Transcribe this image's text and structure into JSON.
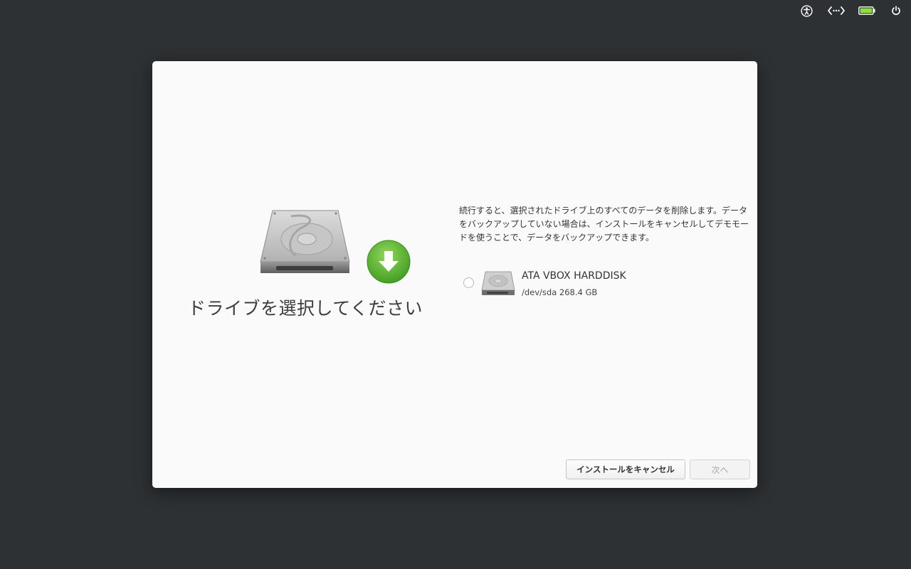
{
  "tray": {
    "icons": [
      "accessibility-icon",
      "network-icon",
      "battery-icon",
      "power-icon"
    ],
    "battery_color": "#8ae234"
  },
  "installer": {
    "title": "ドライブを選択してください",
    "description": "続行すると、選択されたドライブ上のすべてのデータを削除します。データをバックアップしていない場合は、インストールをキャンセルしてデモモードを使うことで、データをバックアップできます。",
    "drives": [
      {
        "name": "ATA VBOX HARDDISK",
        "info": "/dev/sda 268.4 GB",
        "selected": false
      }
    ],
    "buttons": {
      "cancel": "インストールをキャンセル",
      "next": "次へ"
    },
    "accent_green": "#5cb531"
  }
}
